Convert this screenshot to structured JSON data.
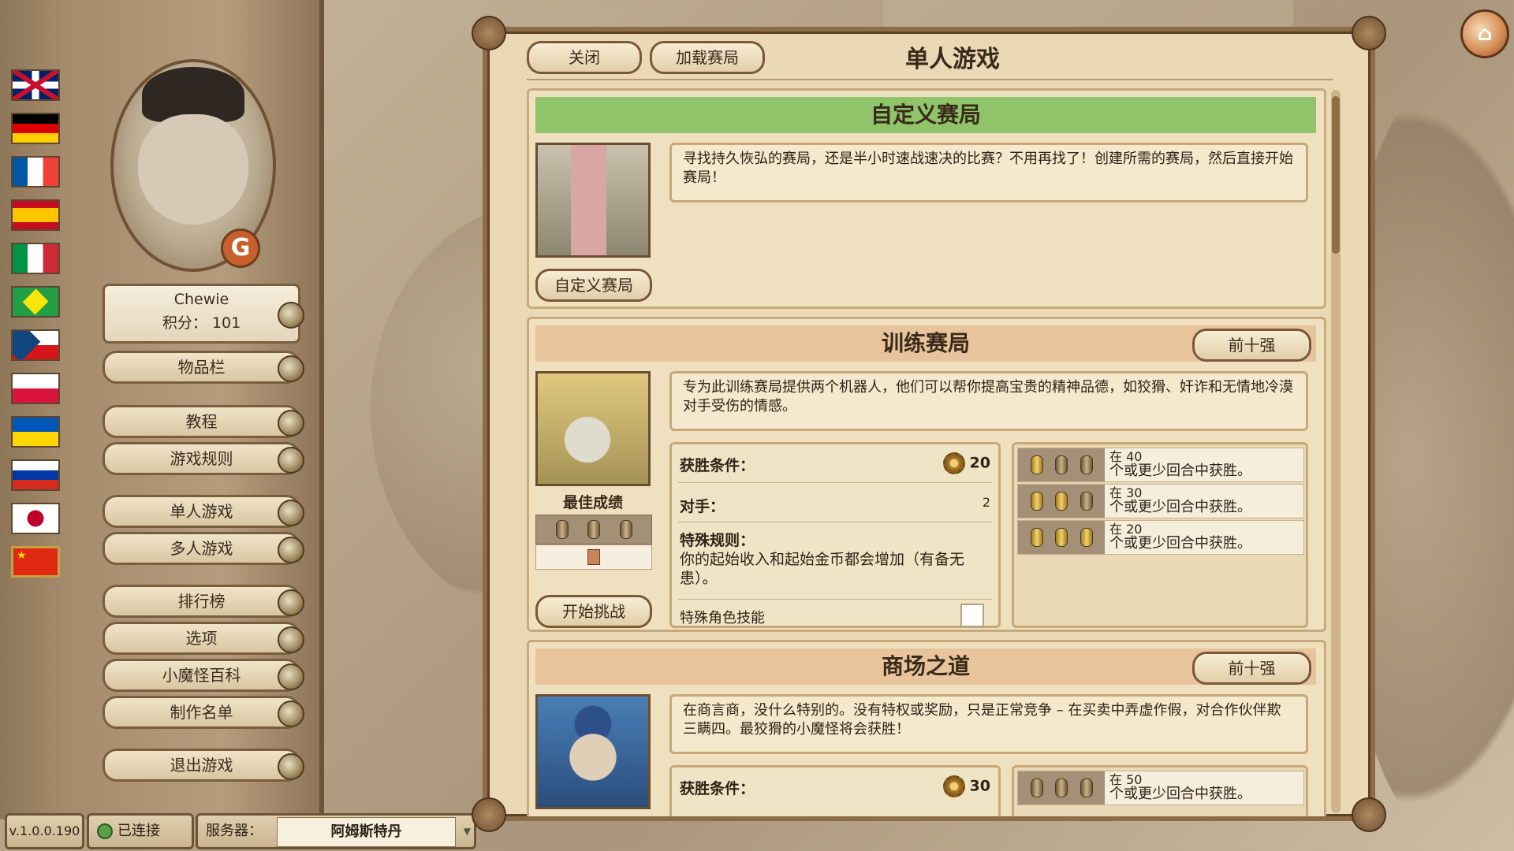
{
  "sidebar": {
    "player_name": "Chewie",
    "score_label": "积分：",
    "score_value": "101",
    "menu": {
      "inventory": "物品栏",
      "tutorial": "教程",
      "rules": "游戏规则",
      "single": "单人游戏",
      "multi": "多人游戏",
      "leaderboard": "排行榜",
      "options": "选项",
      "goblinpedia": "小魔怪百科",
      "credits": "制作名单",
      "quit": "退出游戏"
    }
  },
  "status": {
    "version": "v.1.0.0.190",
    "connected": "已连接",
    "server_label": "服务器：",
    "server_value": "阿姆斯特丹"
  },
  "panel": {
    "close": "关闭",
    "load": "加载赛局",
    "title": "单人游戏"
  },
  "custom": {
    "heading": "自定义赛局",
    "description": "寻找持久恢弘的赛局，还是半小时速战速决的比赛？不用再找了！创建所需的赛局，然后直接开始赛局！",
    "button": "自定义赛局"
  },
  "training": {
    "heading": "训练赛局",
    "top10": "前十强",
    "description": "专为此训练赛局提供两个机器人，他们可以帮你提高宝贵的精神品德，如狡猾、奸诈和无情地冷漠对手受伤的情感。",
    "best_label": "最佳成绩",
    "start": "开始挑战",
    "win_label": "获胜条件：",
    "win_value": "20",
    "opponents_label": "对手：",
    "opponents_value": "2",
    "special_label": "特殊规则：",
    "special_text": "你的起始收入和起始金币都会增加（有备无患）。",
    "special_role_label": "特殊角色技能",
    "goals": [
      {
        "line1": "在 40",
        "line2": "个或更少回合中获胜。"
      },
      {
        "line1": "在 30",
        "line2": "个或更少回合中获胜。"
      },
      {
        "line1": "在 20",
        "line2": "个或更少回合中获胜。"
      }
    ]
  },
  "mall": {
    "heading": "商场之道",
    "top10": "前十强",
    "description": "在商言商，没什么特别的。没有特权或奖励，只是正常竞争 – 在买卖中弄虚作假，对合作伙伴欺三瞒四。最狡猾的小魔怪将会获胜！",
    "win_label": "获胜条件：",
    "win_value": "30",
    "goals": [
      {
        "line1": "在 50",
        "line2": "个或更少回合中获胜。"
      }
    ]
  }
}
